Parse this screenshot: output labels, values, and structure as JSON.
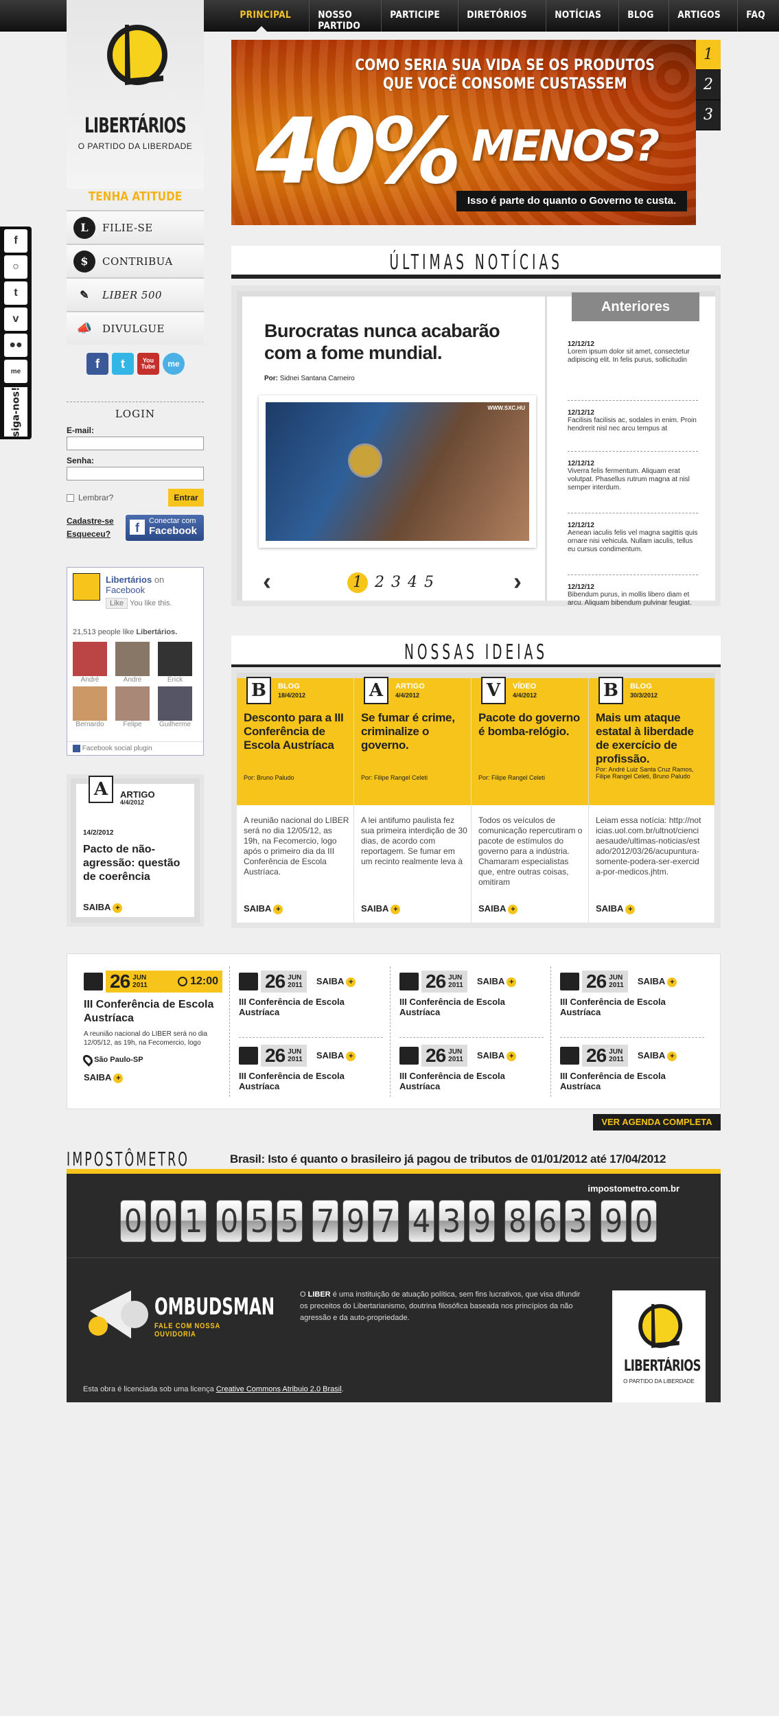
{
  "nav": {
    "items": [
      "PRINCIPAL",
      "NOSSO PARTIDO",
      "PARTICIPE",
      "DIRETÓRIOS",
      "NOTÍCIAS",
      "BLOG",
      "ARTIGOS",
      "FAQ"
    ]
  },
  "brand": {
    "name": "LIBERTÁRIOS",
    "tagline": "O PARTIDO DA LIBERDADE"
  },
  "sidebar": {
    "heading": "TENHA ATITUDE",
    "items": [
      {
        "label": "FILIE-SE",
        "icon": "L"
      },
      {
        "label": "CONTRIBUA",
        "icon": "$"
      },
      {
        "label": "LIBER 500",
        "icon": "✎"
      },
      {
        "label": "DIVULGUE",
        "icon": "📣"
      }
    ],
    "socials": [
      "f",
      "t",
      "You Tube",
      "me"
    ],
    "siga": "siga-nos!"
  },
  "login": {
    "title": "LOGIN",
    "email_label": "E-mail:",
    "password_label": "Senha:",
    "remember": "Lembrar?",
    "submit": "Entrar",
    "signup": "Cadastre-se",
    "forgot": "Esqueceu?",
    "fb_button_line1": "Conectar com",
    "fb_button_line2": "Facebook"
  },
  "fb_box": {
    "page": "Libertários",
    "on": "on",
    "network": "Facebook",
    "like": "Like",
    "you_like": "You like this.",
    "count_text": "21,513 people like",
    "count_page": "Libertários.",
    "people": [
      "André",
      "Andre",
      "Erick",
      "Bernardo",
      "Felipe",
      "Guilherme"
    ],
    "plugin": "Facebook social plugin"
  },
  "side_artigo": {
    "letter": "A",
    "category": "ARTIGO",
    "date": "4/4/2012",
    "post_date": "14/2/2012",
    "title": "Pacto de não-agressão: questão de coerência",
    "more": "SAIBA"
  },
  "slider": {
    "line1": "COMO SERIA SUA VIDA SE OS PRODUTOS",
    "line2": "QUE VOCÊ CONSOME CUSTASSEM",
    "big": "40%",
    "menos": "MENOS?",
    "caption": "Isso é parte do quanto o Governo te custa.",
    "pages": [
      "1",
      "2",
      "3"
    ]
  },
  "news": {
    "section_title": "ÚLTIMAS NOTÍCIAS",
    "headline": "Burocratas nunca acabarão com a fome mundial.",
    "by_label": "Por:",
    "author": "Sidnei Santana Carneiro",
    "photo_credit": "WWW.SXC.HU",
    "pager": [
      "1",
      "2",
      "3",
      "4",
      "5"
    ],
    "prev": "‹",
    "next": "›",
    "anteriores": "Anteriores",
    "side": [
      {
        "date": "12/12/12",
        "text": "Lorem ipsum dolor sit amet, consectetur adipiscing elit. In felis purus, sollicitudin"
      },
      {
        "date": "12/12/12",
        "text": "Facilisis facilisis ac, sodales in enim. Proin hendrerit nisl nec arcu tempus at"
      },
      {
        "date": "12/12/12",
        "text": "Viverra felis fermentum. Aliquam erat volutpat. Phasellus rutrum magna at nisl semper interdum."
      },
      {
        "date": "12/12/12",
        "text": "Aenean iaculis felis vel magna sagittis quis ornare nisi vehicula. Nullam iaculis, tellus eu cursus condimentum."
      },
      {
        "date": "12/12/12",
        "text": "Bibendum purus, in mollis libero diam et arcu. Aliquam bibendum pulvinar feugiat."
      }
    ]
  },
  "ideas": {
    "section_title": "NOSSAS IDEIAS",
    "items": [
      {
        "letter": "B",
        "category": "BLOG",
        "date": "18/4/2012",
        "title": "Desconto para a III Conferência de Escola Austríaca",
        "by": "Por: Bruno Paludo",
        "text": "A reunião nacional do LIBER será no dia 12/05/12, as 19h, na Fecomercio, logo após o primeiro dia da III Conferência de Escola Austríaca.",
        "more": "SAIBA"
      },
      {
        "letter": "A",
        "category": "ARTIGO",
        "date": "4/4/2012",
        "title": "Se fumar é crime, criminalize o governo.",
        "by": "Por: Filipe Rangel Celeti",
        "text": "A lei antifumo paulista fez sua primeira interdição de 30 dias, de acordo com reportagem. Se fumar em um recinto realmente leva à",
        "more": "SAIBA"
      },
      {
        "letter": "V",
        "category": "VÍDEO",
        "date": "4/4/2012",
        "title": "Pacote do governo é bomba-relógio.",
        "by": "Por: Filipe Rangel Celeti",
        "text": "Todos os veículos de comunicação repercutiram o pacote de estímulos do governo para a indústria. Chamaram especialistas que, entre outras coisas, omitiram",
        "more": "SAIBA"
      },
      {
        "letter": "B",
        "category": "BLOG",
        "date": "30/3/2012",
        "title": "Mais um ataque estatal à liberdade de exercício de profissão.",
        "by": "Por: André Luiz Santa Cruz Ramos, Filipe Rangel Celeti, Bruno Paludo",
        "text": "Leiam essa notícia: http://noticias.uol.com.br/ultnot/cienciaesaude/ultimas-noticias/estado/2012/03/26/acupuntura-somente-podera-ser-exercida-por-medicos.jhtm.",
        "more": "SAIBA"
      }
    ]
  },
  "agenda": {
    "featured": {
      "day": "26",
      "month": "JUN",
      "year": "2011",
      "time": "12:00",
      "title": "III Conferência de Escola Austríaca",
      "text": "A reunião nacional do LIBER será no dia 12/05/12, as 19h, na Fecomercio, logo",
      "place": "São Paulo-SP",
      "more": "SAIBA"
    },
    "items": [
      {
        "day": "26",
        "month": "JUN",
        "year": "2011",
        "title": "III Conferência de Escola Austríaca",
        "more": "SAIBA"
      },
      {
        "day": "26",
        "month": "JUN",
        "year": "2011",
        "title": "III Conferência de Escola Austríaca",
        "more": "SAIBA"
      },
      {
        "day": "26",
        "month": "JUN",
        "year": "2011",
        "title": "III Conferência de Escola Austríaca",
        "more": "SAIBA"
      },
      {
        "day": "26",
        "month": "JUN",
        "year": "2011",
        "title": "III Conferência de Escola Austríaca",
        "more": "SAIBA"
      },
      {
        "day": "26",
        "month": "JUN",
        "year": "2011",
        "title": "III Conferência de Escola Austríaca",
        "more": "SAIBA"
      },
      {
        "day": "26",
        "month": "JUN",
        "year": "2011",
        "title": "III Conferência de Escola Austríaca",
        "more": "SAIBA"
      }
    ],
    "full_button": "VER AGENDA COMPLETA"
  },
  "impostometro": {
    "title": "IMPOSTÔMETRO",
    "subtitle": "Brasil: Isto é quanto o brasileiro já pagou de tributos de 01/01/2012 até 17/04/2012",
    "site": "impostometro.com.br",
    "digits": [
      "0",
      "0",
      "1",
      "0",
      "5",
      "5",
      "7",
      "9",
      "7",
      "4",
      "3",
      "9",
      "8",
      "6",
      "3",
      "9",
      "0"
    ]
  },
  "footer": {
    "ombudsman": "OMBUDSMAN",
    "ombudsman_sub": "FALE COM NOSSA OUVIDORIA",
    "about_brand": "LIBER",
    "about_pre": "O",
    "about": "é uma instituição de atuação política, sem fins lucrativos, que visa difundir os preceitos do Libertarianismo, doutrina filosófica baseada nos princípios da não agressão e da auto-propriedade.",
    "license_pre": "Esta obra é licenciada sob uma licença",
    "license_link": "Creative Commons Atribuio 2.0 Brasil",
    "license_post": "."
  },
  "colors": {
    "accent": "#f6c41b",
    "dark": "#2a2a2a",
    "facebook": "#3b5998"
  }
}
